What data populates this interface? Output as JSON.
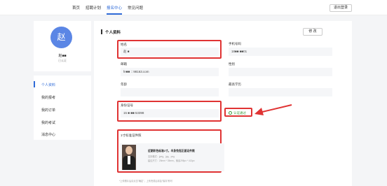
{
  "nav": {
    "items": [
      "首页",
      "招聘计划",
      "报名中心",
      "常见问题"
    ],
    "logout": "退出登录"
  },
  "profile": {
    "avatar_char": "赵",
    "name": "赵■■",
    "status": "已认证"
  },
  "menu": {
    "items": [
      "个人资料",
      "我的报考",
      "我的订单",
      "我的考试",
      "消息中心"
    ]
  },
  "section": {
    "title": "个人资料",
    "edit": "修 改"
  },
  "form": {
    "name_label": "姓名",
    "name_value": "赵 ■",
    "phone_label": "手机号码",
    "phone_value": "18■■ ■■01",
    "email_label": "邮箱",
    "email_value": "fe■■ :: 98163.com",
    "gender_label": "性别",
    "age_label": "年龄",
    "edu_label": "最高学历",
    "id_label": "身份证号",
    "id_value": "15 ■ ■■ 53398",
    "verify_text": "认证通过"
  },
  "photo": {
    "label": "1寸标准证件照",
    "title": "近期彩色标准1寸。半身免冠正面证件照",
    "lines": [
      "支持格式：jpeg、jpg、png",
      "建议尺寸：25mm * 35mm，像素295px * 413px"
    ],
    "footer": "*上传照片后请点击\"确定\"，上传完成后将会\"保存\"即可"
  },
  "colors": {
    "accent": "#2f6bd8",
    "highlight": "#e03333",
    "success": "#3a9a3a"
  }
}
